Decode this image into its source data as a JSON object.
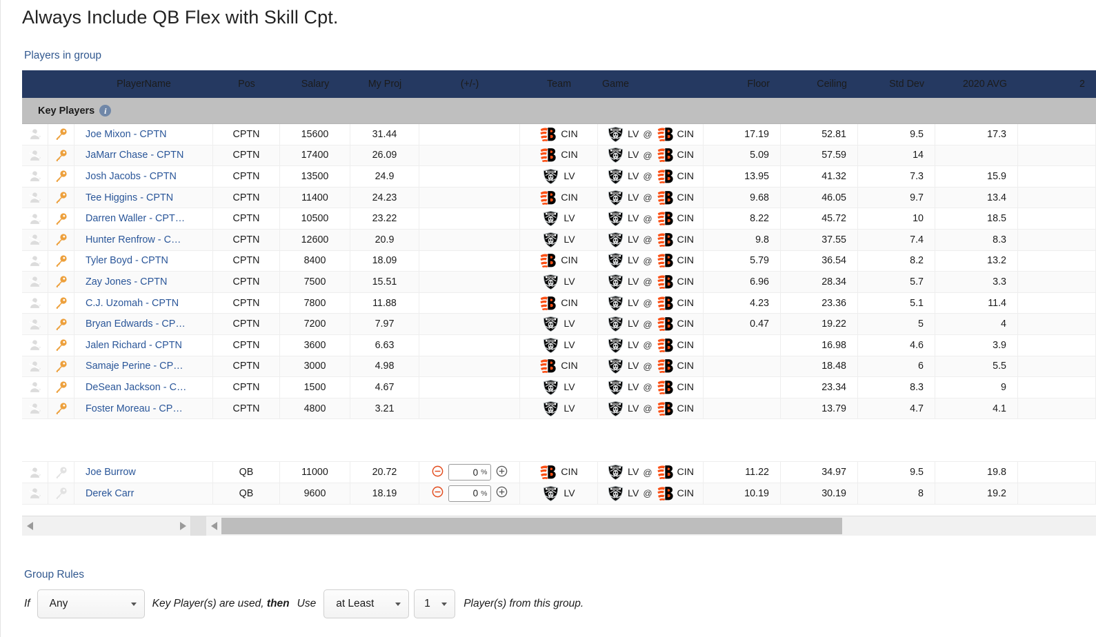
{
  "page": {
    "title": "Always Include QB Flex with Skill Cpt.",
    "players_section_label": "Players in group",
    "rules_section_label": "Group Rules"
  },
  "colors": {
    "header_bg": "#253961",
    "key_row_bg": "#bfbfbf",
    "link_blue": "#2a5699",
    "label_blue": "#31588f",
    "key_icon_orange": "#eda03c",
    "stepper_orange": "#e24a1b",
    "bengals_orange": "#fb4f14",
    "raiders_black": "#000000"
  },
  "table": {
    "columns": [
      {
        "key": "exclude",
        "label": ""
      },
      {
        "key": "key",
        "label": ""
      },
      {
        "key": "player_name",
        "label": "PlayerName"
      },
      {
        "key": "pos",
        "label": "Pos"
      },
      {
        "key": "salary",
        "label": "Salary"
      },
      {
        "key": "my_proj",
        "label": "My Proj"
      },
      {
        "key": "plus_minus",
        "label": "(+/-)"
      },
      {
        "key": "team",
        "label": "Team"
      },
      {
        "key": "game",
        "label": "Game"
      },
      {
        "key": "floor",
        "label": "Floor"
      },
      {
        "key": "ceiling",
        "label": "Ceiling"
      },
      {
        "key": "std_dev",
        "label": "Std Dev"
      },
      {
        "key": "avg_2020",
        "label": "2020 AVG"
      },
      {
        "key": "avg_next",
        "label": "2"
      }
    ],
    "key_players_group": {
      "label": "Key Players",
      "info_icon": "info-icon"
    },
    "key_player_rows": [
      {
        "name": "Joe Mixon - CPTN",
        "pos": "CPTN",
        "salary": "15600",
        "proj": "31.44",
        "team": "CIN",
        "game_away": "LV",
        "game_home": "CIN",
        "floor": "17.19",
        "ceiling": "52.81",
        "std_dev": "9.5",
        "avg_2020": "17.3"
      },
      {
        "name": "JaMarr Chase - CPTN",
        "pos": "CPTN",
        "salary": "17400",
        "proj": "26.09",
        "team": "CIN",
        "game_away": "LV",
        "game_home": "CIN",
        "floor": "5.09",
        "ceiling": "57.59",
        "std_dev": "14",
        "avg_2020": ""
      },
      {
        "name": "Josh Jacobs - CPTN",
        "pos": "CPTN",
        "salary": "13500",
        "proj": "24.9",
        "team": "LV",
        "game_away": "LV",
        "game_home": "CIN",
        "floor": "13.95",
        "ceiling": "41.32",
        "std_dev": "7.3",
        "avg_2020": "15.9"
      },
      {
        "name": "Tee Higgins - CPTN",
        "pos": "CPTN",
        "salary": "11400",
        "proj": "24.23",
        "team": "CIN",
        "game_away": "LV",
        "game_home": "CIN",
        "floor": "9.68",
        "ceiling": "46.05",
        "std_dev": "9.7",
        "avg_2020": "13.4"
      },
      {
        "name": "Darren Waller - CPT…",
        "pos": "CPTN",
        "salary": "10500",
        "proj": "23.22",
        "team": "LV",
        "game_away": "LV",
        "game_home": "CIN",
        "floor": "8.22",
        "ceiling": "45.72",
        "std_dev": "10",
        "avg_2020": "18.5"
      },
      {
        "name": "Hunter Renfrow - C…",
        "pos": "CPTN",
        "salary": "12600",
        "proj": "20.9",
        "team": "LV",
        "game_away": "LV",
        "game_home": "CIN",
        "floor": "9.8",
        "ceiling": "37.55",
        "std_dev": "7.4",
        "avg_2020": "8.3"
      },
      {
        "name": "Tyler Boyd - CPTN",
        "pos": "CPTN",
        "salary": "8400",
        "proj": "18.09",
        "team": "CIN",
        "game_away": "LV",
        "game_home": "CIN",
        "floor": "5.79",
        "ceiling": "36.54",
        "std_dev": "8.2",
        "avg_2020": "13.2"
      },
      {
        "name": "Zay Jones - CPTN",
        "pos": "CPTN",
        "salary": "7500",
        "proj": "15.51",
        "team": "LV",
        "game_away": "LV",
        "game_home": "CIN",
        "floor": "6.96",
        "ceiling": "28.34",
        "std_dev": "5.7",
        "avg_2020": "3.3"
      },
      {
        "name": "C.J. Uzomah - CPTN",
        "pos": "CPTN",
        "salary": "7800",
        "proj": "11.88",
        "team": "CIN",
        "game_away": "LV",
        "game_home": "CIN",
        "floor": "4.23",
        "ceiling": "23.36",
        "std_dev": "5.1",
        "avg_2020": "11.4"
      },
      {
        "name": "Bryan Edwards - CP…",
        "pos": "CPTN",
        "salary": "7200",
        "proj": "7.97",
        "team": "LV",
        "game_away": "LV",
        "game_home": "CIN",
        "floor": "0.47",
        "ceiling": "19.22",
        "std_dev": "5",
        "avg_2020": "4"
      },
      {
        "name": "Jalen Richard - CPTN",
        "pos": "CPTN",
        "salary": "3600",
        "proj": "6.63",
        "team": "LV",
        "game_away": "LV",
        "game_home": "CIN",
        "floor": "",
        "ceiling": "16.98",
        "std_dev": "4.6",
        "avg_2020": "3.9"
      },
      {
        "name": "Samaje Perine - CP…",
        "pos": "CPTN",
        "salary": "3000",
        "proj": "4.98",
        "team": "CIN",
        "game_away": "LV",
        "game_home": "CIN",
        "floor": "",
        "ceiling": "18.48",
        "std_dev": "6",
        "avg_2020": "5.5"
      },
      {
        "name": "DeSean Jackson - C…",
        "pos": "CPTN",
        "salary": "1500",
        "proj": "4.67",
        "team": "LV",
        "game_away": "LV",
        "game_home": "CIN",
        "floor": "",
        "ceiling": "23.34",
        "std_dev": "8.3",
        "avg_2020": "9"
      },
      {
        "name": "Foster Moreau - CP…",
        "pos": "CPTN",
        "salary": "4800",
        "proj": "3.21",
        "team": "LV",
        "game_away": "LV",
        "game_home": "CIN",
        "floor": "",
        "ceiling": "13.79",
        "std_dev": "4.7",
        "avg_2020": "4.1"
      }
    ],
    "other_player_rows": [
      {
        "name": "Joe Burrow",
        "pos": "QB",
        "salary": "11000",
        "proj": "20.72",
        "pct": "0",
        "pct_sign": "%",
        "team": "CIN",
        "game_away": "LV",
        "game_home": "CIN",
        "floor": "11.22",
        "ceiling": "34.97",
        "std_dev": "9.5",
        "avg_2020": "19.8"
      },
      {
        "name": "Derek Carr",
        "pos": "QB",
        "salary": "9600",
        "proj": "18.19",
        "pct": "0",
        "pct_sign": "%",
        "team": "LV",
        "game_away": "LV",
        "game_home": "CIN",
        "floor": "10.19",
        "ceiling": "30.19",
        "std_dev": "8",
        "avg_2020": "19.2"
      }
    ]
  },
  "group_rules": {
    "if_label": "If",
    "condition_value": "Any",
    "mid_text": "Key Player(s) are used,",
    "then_text": "then",
    "use_label": "Use",
    "quantifier_value": "at Least",
    "count_value": "1",
    "suffix_text": "Player(s) from this group."
  }
}
